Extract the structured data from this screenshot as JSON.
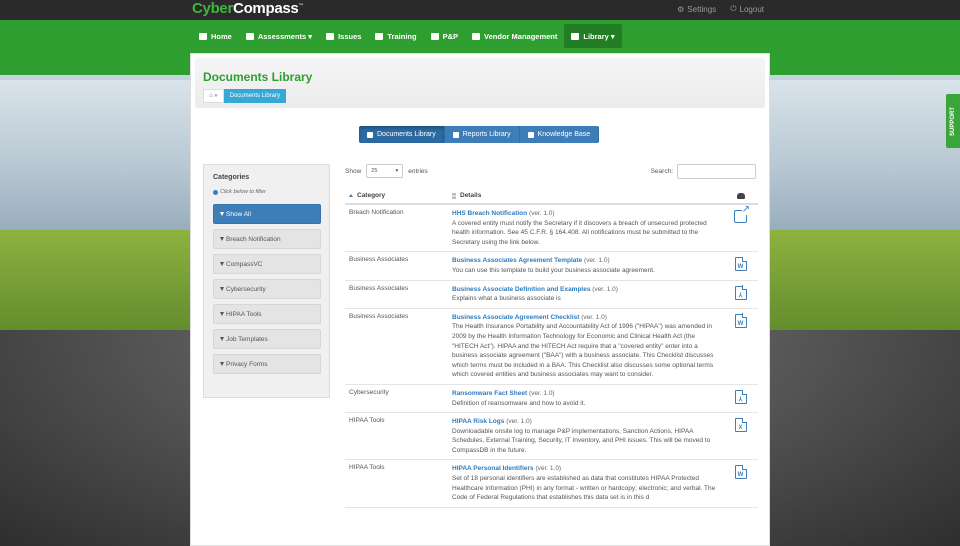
{
  "brand": {
    "part1": "Cyber",
    "part2": "Compass",
    "tm": "™"
  },
  "topbar": {
    "settings": "Settings",
    "logout": "Logout"
  },
  "nav": [
    {
      "label": "Home",
      "icon": "dashboard-icon"
    },
    {
      "label": "Assessments ▾",
      "icon": "list-icon"
    },
    {
      "label": "Issues",
      "icon": "wrench-icon"
    },
    {
      "label": "Training",
      "icon": "graduation-cap-icon"
    },
    {
      "label": "P&P",
      "icon": "book-icon"
    },
    {
      "label": "Vendor Management",
      "icon": "vendor-icon"
    },
    {
      "label": "Library ▾",
      "icon": "folder-icon"
    }
  ],
  "support_label": "SUPPORT",
  "page": {
    "title": "Documents Library",
    "breadcrumb_home": "⌂ »",
    "breadcrumb_current": "Documents Library"
  },
  "tabs": [
    {
      "label": "Documents Library"
    },
    {
      "label": "Reports Library"
    },
    {
      "label": "Knowledge Base"
    }
  ],
  "categories": {
    "title": "Categories",
    "hint": "Click below to filter",
    "items": [
      "Show All",
      "Breach Notification",
      "CompassVC",
      "Cybersecurity",
      "HIPAA Tools",
      "Job Templates",
      "Privacy Forms"
    ]
  },
  "table_controls": {
    "show_label": "Show",
    "page_size": "25",
    "entries_label": "entries",
    "search_label": "Search:"
  },
  "table": {
    "headers": {
      "category": "Category",
      "details": "Details"
    },
    "rows": [
      {
        "category": "Breach Notification",
        "title": "HHS Breach Notification",
        "version": "(ver. 1.0)",
        "description": "A covered entity must notify the Secretary if it discovers a breach of unsecured protected health information. See 45 C.F.R. § 164.408. All notifications must be submitted to the Secretary using the link below.",
        "file_type": "external-link"
      },
      {
        "category": "Business Associates",
        "title": "Business Associates Agreement Template",
        "version": "(ver. 1.0)",
        "description": "You can use this template to build your business associate agreement.",
        "file_type": "word"
      },
      {
        "category": "Business Associates",
        "title": "Business Associate Definition and Examples",
        "version": "(ver. 1.0)",
        "description": "Explains what a business associate is",
        "file_type": "pdf"
      },
      {
        "category": "Business Associates",
        "title": "Business Associate Agreement Checklist",
        "version": "(ver. 1.0)",
        "description": "The Health Insurance Portability and Accountability Act of 1996 (\"HIPAA\") was amended in 2009 by the Health Information Technology for Economic and Clinical Health Act (the \"HITECH Act\"). HIPAA and the HITECH Act require that a \"covered entity\" enter into a business associate agreement (\"BAA\") with a business associate. This Checklist discusses which terms must be included in a BAA. This Checklist also discusses some optional terms which covered entities and business associates may want to consider.",
        "file_type": "word"
      },
      {
        "category": "Cybersecurity",
        "title": "Ransomware Fact Sheet",
        "version": "(ver. 1.0)",
        "description": "Definition of reansomware and how to avoid it.",
        "file_type": "pdf"
      },
      {
        "category": "HIPAA Tools",
        "title": "HIPAA Risk Logs",
        "version": "(ver. 1.0)",
        "description": "Downloadable onsite log to manage P&P implementations, Sanction Actions, HIPAA Schedules, External Training, Security, IT Inventory, and PHI issues. This will be moved to CompassDB in the future.",
        "file_type": "excel"
      },
      {
        "category": "HIPAA Tools",
        "title": "HIPAA Personal Identifiers",
        "version": "(ver. 1.0)",
        "description": "Set of 18 personal identifiers are established as data that constitutes HIPAA Protected Healthcare Information (PHI) in any format - written or hardcopy; electronic; and verbal. The Code of Federal Regulations that establishes this data set is in this d",
        "file_type": "word"
      }
    ]
  }
}
